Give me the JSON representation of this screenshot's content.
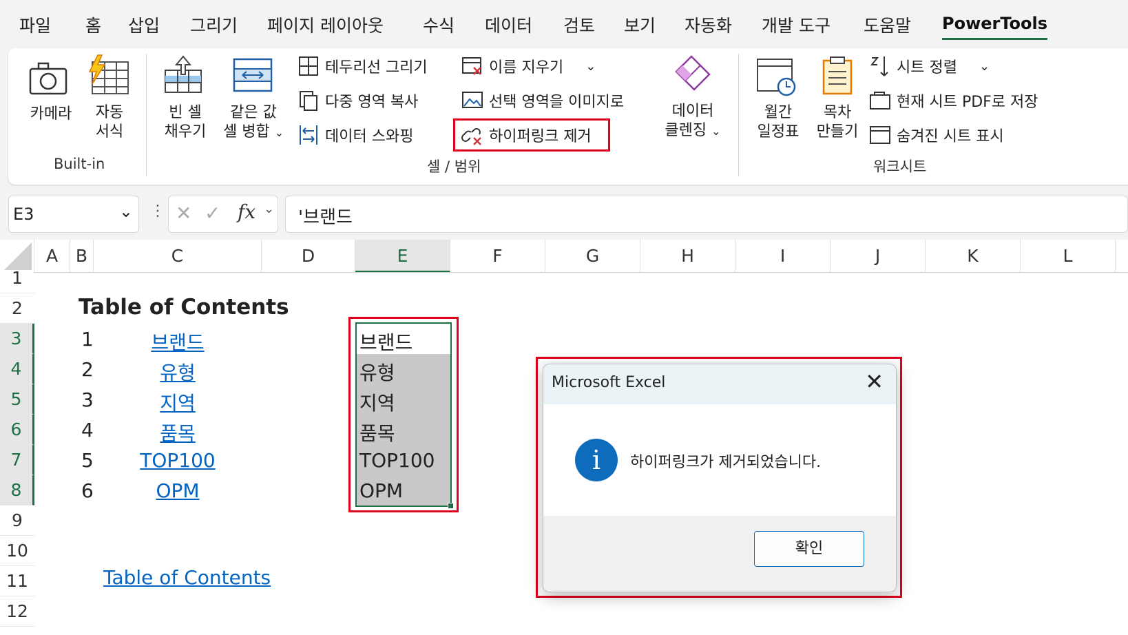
{
  "menu": {
    "items": [
      "파일",
      "홈",
      "삽입",
      "그리기",
      "페이지 레이아웃",
      "수식",
      "데이터",
      "검토",
      "보기",
      "자동화",
      "개발 도구",
      "도움말",
      "PowerTools"
    ],
    "active_index": 12
  },
  "ribbon": {
    "builtin": {
      "camera": "카메라",
      "autoformat_1": "자동",
      "autoformat_2": "서식",
      "group": "Built-in"
    },
    "cell_range": {
      "fill_blank_1": "빈 셀",
      "fill_blank_2": "채우기",
      "merge_same_1": "같은 값",
      "merge_same_2": "셀 병합",
      "draw_borders": "테두리선 그리기",
      "multi_copy": "다중 영역 복사",
      "swap_data": "데이터 스와핑",
      "clear_names": "이름 지우기",
      "selection_to_image": "선택 영역을 이미지로",
      "remove_hyperlink": "하이퍼링크 제거",
      "cleansing_1": "데이터",
      "cleansing_2": "클렌징",
      "group": "셀 / 범위"
    },
    "worksheet": {
      "monthly_1": "월간",
      "monthly_2": "일정표",
      "toc_1": "목차",
      "toc_2": "만들기",
      "sort_sheets": "시트 정렬",
      "save_pdf": "현재 시트 PDF로 저장",
      "show_hidden": "숨겨진 시트 표시",
      "group": "워크시트"
    }
  },
  "formula_bar": {
    "name_box": "E3",
    "fx": "fx",
    "content": "'브랜드"
  },
  "columns": [
    "A",
    "B",
    "C",
    "D",
    "E",
    "F",
    "G",
    "H",
    "I",
    "J",
    "K",
    "L"
  ],
  "selected_column": "E",
  "rows": [
    "1",
    "2",
    "3",
    "4",
    "5",
    "6",
    "7",
    "8",
    "9",
    "10",
    "11",
    "12"
  ],
  "sheet": {
    "title": "Table of Contents",
    "toc_numbers": [
      "1",
      "2",
      "3",
      "4",
      "5",
      "6"
    ],
    "toc_links": [
      "브랜드",
      "유형",
      "지역",
      "품목",
      "TOP100",
      "OPM"
    ],
    "e_column_values": [
      "브랜드",
      "유형",
      "지역",
      "품목",
      "TOP100",
      "OPM"
    ],
    "bottom_link": "Table of Contents"
  },
  "dialog": {
    "title": "Microsoft Excel",
    "message": "하이퍼링크가 제거되었습니다.",
    "ok_label": "확인",
    "info_glyph": "i"
  },
  "colors": {
    "accent_green": "#1e7145",
    "highlight_red": "#e0001b",
    "link_blue": "#0563c1",
    "info_blue": "#0f6cbd"
  }
}
